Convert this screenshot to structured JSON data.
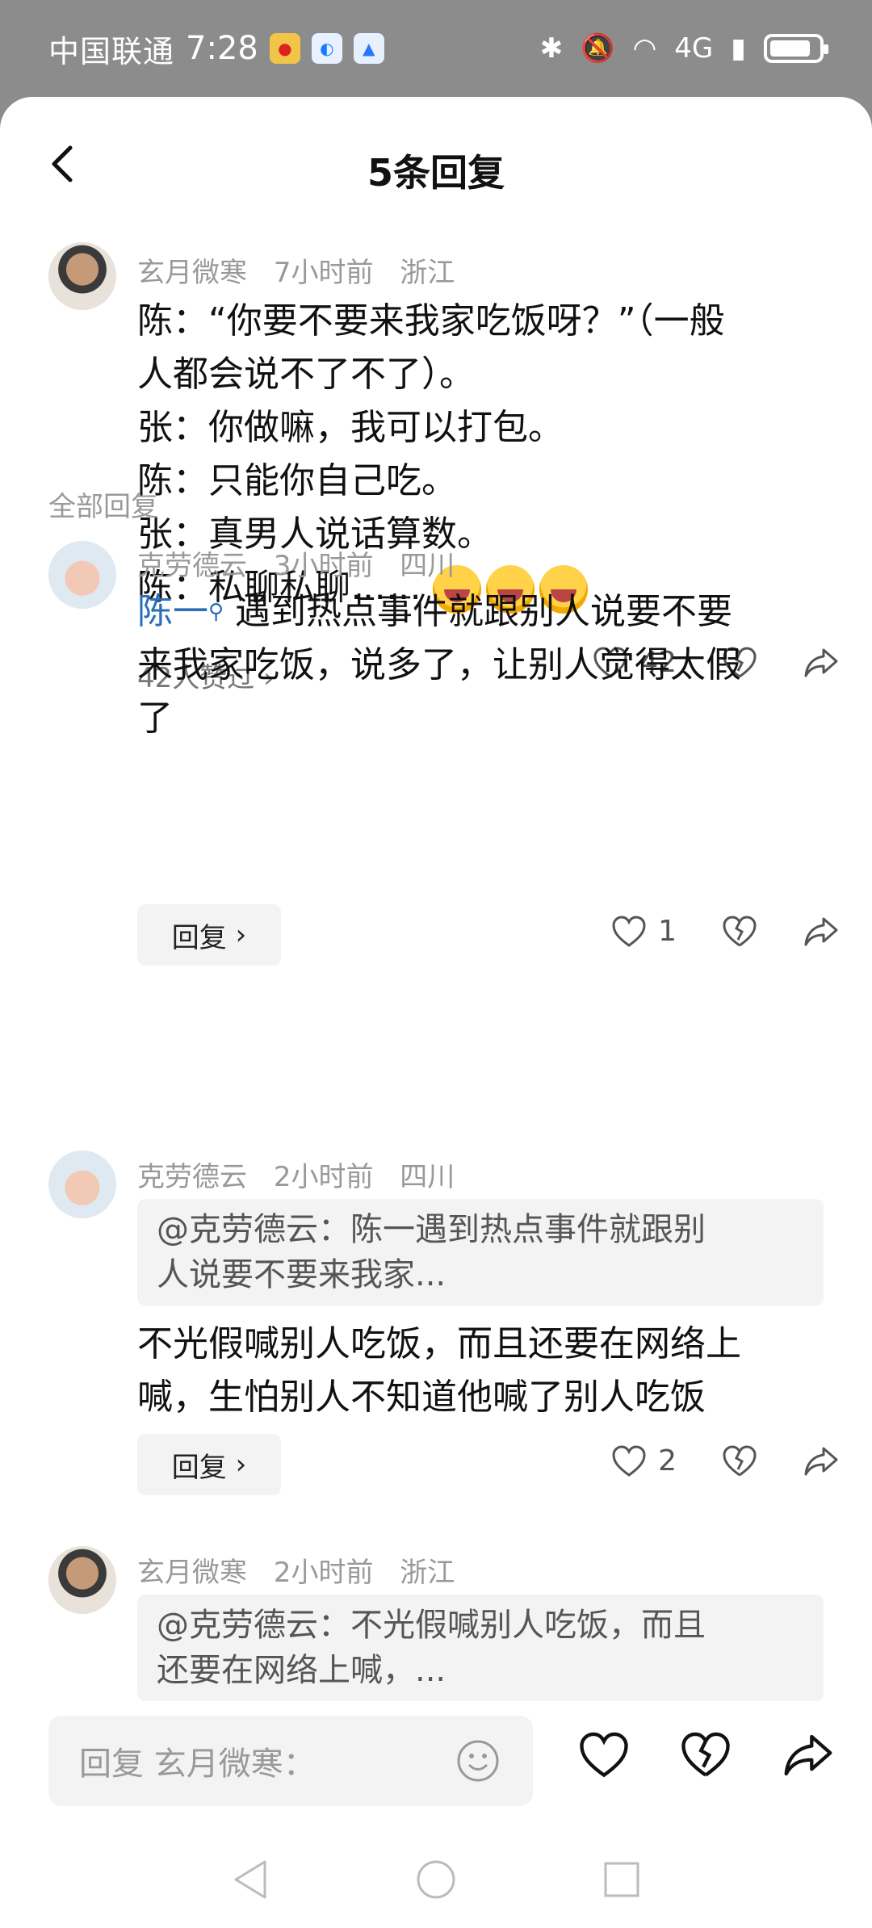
{
  "status_bar": {
    "carrier": "中国联通",
    "time": "7:28",
    "apps": [
      "weibo-app-icon",
      "browser-app-icon",
      "baidu-app-icon"
    ],
    "network": "4G",
    "battery_level": 0.85
  },
  "header": {
    "title": "5条回复"
  },
  "root_comment": {
    "author": "玄月微寒",
    "time": "7小时前",
    "location": "浙江",
    "lines": [
      "陈：“你要不要来我家吃饭呀？”（一般",
      "人都会说不了不了）。",
      "张：你做嘛，我可以打包。",
      "陈：只能你自己吃。",
      "张：真男人说话算数。",
      "陈：私聊私聊……"
    ],
    "likers_text": "42人赞过",
    "like_count": "42"
  },
  "section": {
    "label": "全部回复"
  },
  "replies": [
    {
      "author": "克劳德云",
      "time": "3小时前",
      "location": "四川",
      "mention": "陈一",
      "text_line1": "遇到热点事件就跟别人说要不要",
      "text_line2": "来我家吃饭，说多了，让别人觉得太假",
      "text_line3": "了",
      "reply_label": "回复",
      "like_count": "1"
    },
    {
      "author": "克劳德云",
      "time": "2小时前",
      "location": "四川",
      "quote_line1": "@克劳德云：陈一遇到热点事件就跟别",
      "quote_line2": "人说要不要来我家...",
      "text_line1": "不光假喊别人吃饭，而且还要在网络上",
      "text_line2": "喊，生怕别人不知道他喊了别人吃饭",
      "reply_label": "回复",
      "like_count": "2"
    },
    {
      "author": "玄月微寒",
      "time": "2小时前",
      "location": "浙江",
      "quote_line1": "@克劳德云：不光假喊别人吃饭，而且",
      "quote_line2": "还要在网络上喊，..."
    }
  ],
  "input": {
    "placeholder": "回复 玄月微寒："
  },
  "colors": {
    "mention": "#2a6fb8",
    "meta": "#999999",
    "status_bg": "#8c8c8c"
  }
}
